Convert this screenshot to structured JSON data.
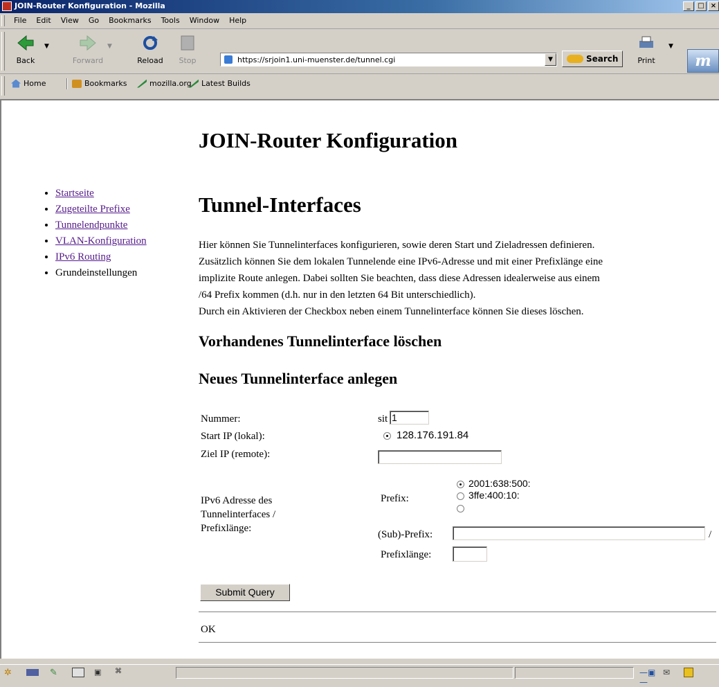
{
  "window": {
    "title": "JOIN-Router Konfiguration - Mozilla"
  },
  "menu": [
    "File",
    "Edit",
    "View",
    "Go",
    "Bookmarks",
    "Tools",
    "Window",
    "Help"
  ],
  "toolbar": {
    "back": "Back",
    "forward": "Forward",
    "reload": "Reload",
    "stop": "Stop",
    "url": "https://srjoin1.uni-muenster.de/tunnel.cgi",
    "search": "Search",
    "print": "Print"
  },
  "personal_toolbar": [
    "Home",
    "Bookmarks",
    "mozilla.org",
    "Latest Builds"
  ],
  "page": {
    "heading": "JOIN-Router Konfiguration",
    "nav": [
      "Startseite",
      "Zugeteilte Prefixe",
      "Tunnelendpunkte",
      "VLAN-Konfiguration",
      "IPv6 Routing",
      "Grundeinstellungen"
    ],
    "section_title": "Tunnel-Interfaces",
    "intro": [
      "Hier können Sie Tunnelinterfaces konfigurieren, sowie deren Start und Zieladressen definieren.",
      "Zusätzlich können Sie dem lokalen Tunnelende eine IPv6-Adresse und mit einer Prefixlänge eine",
      "implizite Route anlegen. Dabei sollten Sie beachten, dass diese Adressen idealerweise aus einem",
      "/64 Prefix kommen (d.h. nur in den letzten 64 Bit unterschiedlich).",
      "Durch ein Aktivieren der Checkbox neben einem Tunnelinterface können Sie dieses löschen."
    ],
    "delete_title": "Vorhandenes Tunnelinterface löschen",
    "new_title": "Neues Tunnelinterface anlegen",
    "form": {
      "nummer_label": "Nummer:",
      "nummer_prefix": "sit",
      "nummer_value": "1",
      "start_label": "Start IP (lokal):",
      "start_value": "128.176.191.84",
      "ziel_label": "Ziel IP (remote):",
      "ziel_value": "",
      "ipv6_label": [
        "IPv6 Adresse des",
        "Tunnelinterfaces /",
        "Prefixlänge:"
      ],
      "prefix_label": "Prefix:",
      "prefix_options": [
        "2001:638:500:",
        "3ffe:400:10:",
        ""
      ],
      "prefix_selected": 0,
      "subprefix_label": "(Sub)-Prefix:",
      "subprefix_value": "",
      "slash": "/",
      "prefixlen_label": "Prefixlänge:",
      "prefixlen_value": "",
      "submit": "Submit Query"
    },
    "status": "OK"
  }
}
